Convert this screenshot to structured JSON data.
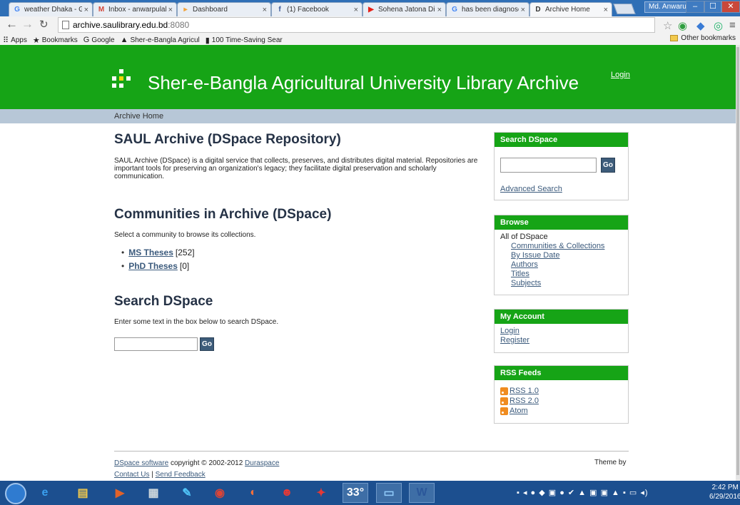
{
  "browser": {
    "tabs": [
      {
        "title": "weather Dhaka - Go",
        "icon": "google-icon",
        "color": "#4285f4",
        "glyph": "G"
      },
      {
        "title": "Inbox - anwarpulak",
        "icon": "gmail-icon",
        "color": "#d44638",
        "glyph": "M"
      },
      {
        "title": "Dashboard",
        "icon": "dashboard-icon",
        "color": "#f2a33a",
        "glyph": "▸"
      },
      {
        "title": "(1) Facebook",
        "icon": "facebook-icon",
        "color": "#3b5998",
        "glyph": "f"
      },
      {
        "title": "Sohena Jatona Dibi",
        "icon": "youtube-icon",
        "color": "#e62117",
        "glyph": "▶"
      },
      {
        "title": "has been diagnosed",
        "icon": "google-icon",
        "color": "#4285f4",
        "glyph": "G"
      },
      {
        "title": "Archive Home",
        "icon": "dspace-icon",
        "color": "#333333",
        "glyph": "D"
      }
    ],
    "user_badge": "Md. Anwarul",
    "window_controls": {
      "minimize": "–",
      "maximize": "☐",
      "close": "✕"
    },
    "url_host": "archive.saulibrary.edu.bd",
    "url_port": ":8080",
    "bookmarks": [
      {
        "label": "Apps",
        "icon": "apps-grid-icon",
        "glyph": "⠿"
      },
      {
        "label": "Bookmarks",
        "icon": "star-icon",
        "glyph": "★"
      },
      {
        "label": "Google",
        "icon": "google-icon",
        "glyph": "G"
      },
      {
        "label": "Sher-e-Bangla Agricul",
        "icon": "site-icon",
        "glyph": "▲"
      },
      {
        "label": "100 Time-Saving Sear",
        "icon": "bookmark-page-icon",
        "glyph": "▮"
      }
    ],
    "other_bookmarks": "Other bookmarks"
  },
  "site": {
    "title": "Sher-e-Bangla Agricultural University Library Archive",
    "login": "Login",
    "breadcrumb": "Archive Home",
    "colors": {
      "brand": "#16a416",
      "trail": "#b7c7d7",
      "heading": "#253246",
      "link": "#3b5a7c"
    }
  },
  "main": {
    "repo_heading": "SAUL Archive (DSpace Repository)",
    "repo_description": "SAUL Archive (DSpace) is a digital service that collects, preserves, and distributes digital material. Repositories are important tools for preserving an organization's legacy; they facilitate digital preservation and scholarly communication.",
    "communities_heading": "Communities in Archive (DSpace)",
    "communities_intro": "Select a community to browse its collections.",
    "communities": [
      {
        "name": "MS Theses",
        "count": "[252]"
      },
      {
        "name": "PhD Theses",
        "count": "[0]"
      }
    ],
    "search_heading": "Search DSpace",
    "search_intro": "Enter some text in the box below to search DSpace.",
    "go_label": "Go"
  },
  "sidebar": {
    "search": {
      "title": "Search DSpace",
      "go_label": "Go",
      "advanced": "Advanced Search"
    },
    "browse": {
      "title": "Browse",
      "root": "All of DSpace",
      "items": [
        "Communities & Collections",
        "By Issue Date",
        "Authors",
        "Titles",
        "Subjects"
      ]
    },
    "account": {
      "title": "My Account",
      "login": "Login",
      "register": "Register"
    },
    "rss": {
      "title": "RSS Feeds",
      "feeds": [
        "RSS 1.0",
        "RSS 2.0",
        "Atom"
      ]
    }
  },
  "footer": {
    "software_link": "DSpace software",
    "copyright": "copyright © 2002-2012",
    "duraspace": "Duraspace",
    "contact": "Contact Us",
    "separator": "|",
    "feedback": "Send Feedback",
    "theme": "Theme by"
  },
  "taskbar": {
    "apps": [
      {
        "name": "ie-icon",
        "glyph": "e"
      },
      {
        "name": "file-explorer-icon",
        "glyph": "▤"
      },
      {
        "name": "media-player-icon",
        "glyph": "▶"
      },
      {
        "name": "calculator-icon",
        "glyph": "▦"
      },
      {
        "name": "notes-icon",
        "glyph": "✎"
      },
      {
        "name": "chrome-icon",
        "glyph": "◉"
      },
      {
        "name": "firefox-icon",
        "glyph": "◐"
      },
      {
        "name": "game-icon",
        "glyph": "☻"
      },
      {
        "name": "pdf-icon",
        "glyph": "✦"
      },
      {
        "name": "weather-widget",
        "glyph": "33°"
      },
      {
        "name": "monitor-icon",
        "glyph": "▭"
      },
      {
        "name": "word-icon",
        "glyph": "W"
      }
    ],
    "tray_icons": "▪ ◂ ● ◆ ▣ ● ✔ ▲ ▣ ▣ ▲ ▪ ▭ ◂)",
    "time": "2:42 PM",
    "date": "6/29/2016"
  }
}
